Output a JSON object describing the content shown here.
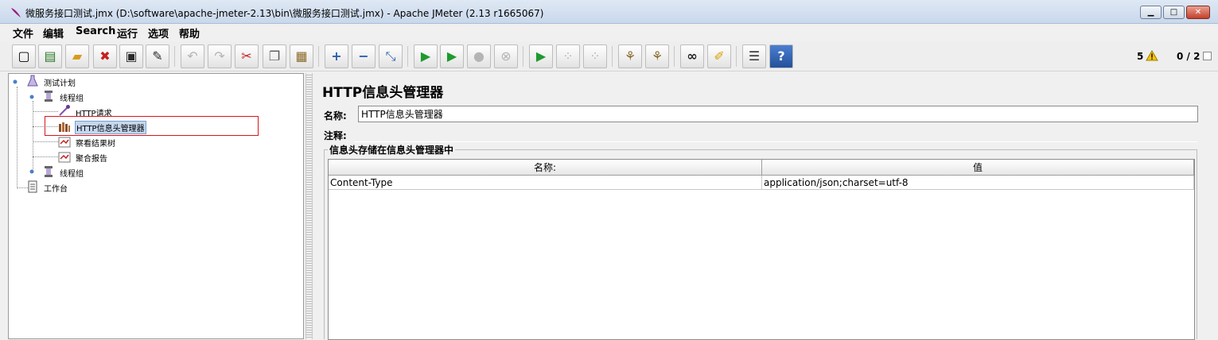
{
  "window": {
    "title": "微服务接口测试.jmx (D:\\software\\apache-jmeter-2.13\\bin\\微服务接口测试.jmx) - Apache JMeter (2.13 r1665067)",
    "minimize_glyph": "▁",
    "maximize_glyph": "□",
    "close_glyph": "✕"
  },
  "menu": [
    "文件",
    "编辑",
    "Search",
    "运行",
    "选项",
    "帮助"
  ],
  "toolbar": {
    "buttons": [
      {
        "name": "new-button",
        "icon": "new-file-icon",
        "glyph": "▢"
      },
      {
        "name": "templates-button",
        "icon": "templates-icon",
        "glyph": "▤"
      },
      {
        "name": "open-button",
        "icon": "folder-icon",
        "glyph": "▰"
      },
      {
        "name": "close-button",
        "icon": "close-file-icon",
        "glyph": "✖"
      },
      {
        "name": "save-button",
        "icon": "save-icon",
        "glyph": "▣"
      },
      {
        "name": "save-as-button",
        "icon": "save-as-icon",
        "glyph": "✎"
      },
      {
        "name": "undo-button",
        "icon": "undo-icon",
        "glyph": "↶"
      },
      {
        "name": "redo-button",
        "icon": "redo-icon",
        "glyph": "↷"
      },
      {
        "name": "cut-button",
        "icon": "scissors-icon",
        "glyph": "✂"
      },
      {
        "name": "copy-button",
        "icon": "copy-icon",
        "glyph": "❐"
      },
      {
        "name": "paste-button",
        "icon": "paste-icon",
        "glyph": "▦"
      },
      {
        "name": "expand-button",
        "icon": "plus-icon",
        "glyph": "+"
      },
      {
        "name": "collapse-button",
        "icon": "minus-icon",
        "glyph": "−"
      },
      {
        "name": "toggle-button",
        "icon": "toggle-icon",
        "glyph": "⤡"
      },
      {
        "name": "start-button",
        "icon": "play-icon",
        "glyph": "▶"
      },
      {
        "name": "start-no-pause-button",
        "icon": "play-timer-icon",
        "glyph": "▶"
      },
      {
        "name": "stop-button",
        "icon": "stop-icon",
        "glyph": "●"
      },
      {
        "name": "shutdown-button",
        "icon": "shutdown-icon",
        "glyph": "⊗"
      },
      {
        "name": "remote-start-button",
        "icon": "remote-play-icon",
        "glyph": "▶"
      },
      {
        "name": "remote-stop-button",
        "icon": "remote-stop-icon",
        "glyph": "⁘"
      },
      {
        "name": "remote-shutdown-button",
        "icon": "remote-shutdown-icon",
        "glyph": "⁘"
      },
      {
        "name": "clear-button",
        "icon": "broom-icon",
        "glyph": "⚘"
      },
      {
        "name": "clear-all-button",
        "icon": "brooms-icon",
        "glyph": "⚘"
      },
      {
        "name": "search-button",
        "icon": "binoculars-icon",
        "glyph": "∞"
      },
      {
        "name": "reset-search-button",
        "icon": "brush-icon",
        "glyph": "✐"
      },
      {
        "name": "function-helper-button",
        "icon": "list-icon",
        "glyph": "☰"
      },
      {
        "name": "help-button",
        "icon": "help-icon",
        "glyph": "?"
      }
    ],
    "warning_count": "5",
    "threads_count": "0 / 2"
  },
  "tree": {
    "test_plan": "测试计划",
    "thread_group_1": "线程组",
    "http_request": "HTTP请求",
    "header_manager": "HTTP信息头管理器",
    "view_results_tree": "察看结果树",
    "aggregate_report": "聚合报告",
    "thread_group_2": "线程组",
    "workbench": "工作台"
  },
  "panel": {
    "title": "HTTP信息头管理器",
    "name_label": "名称:",
    "name_value": "HTTP信息头管理器",
    "comment_label": "注释:",
    "group_title": "信息头存储在信息头管理器中",
    "table": {
      "columns": [
        "名称:",
        "值"
      ],
      "rows": [
        [
          "Content-Type",
          "application/json;charset=utf-8"
        ]
      ]
    }
  },
  "colors": {
    "selection_highlight": "#d4161f",
    "play_green": "#1e9a2e"
  }
}
